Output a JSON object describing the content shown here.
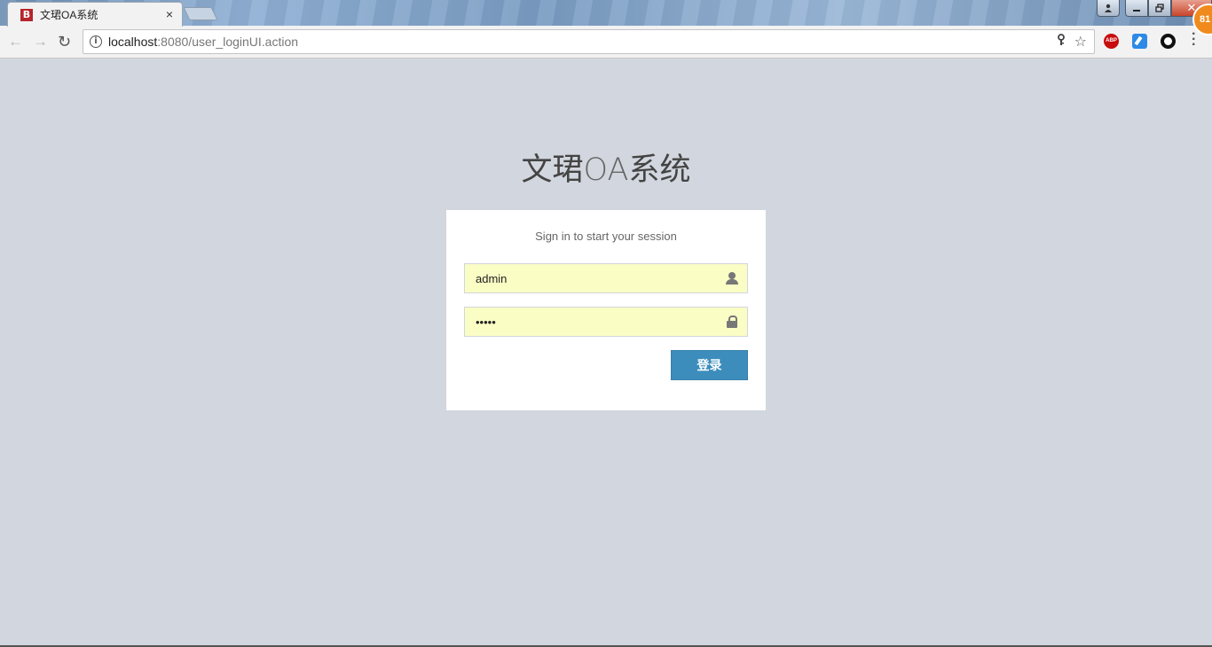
{
  "browser": {
    "tab": {
      "favicon_letter": "B",
      "title": "文珺OA系统",
      "close_glyph": "×"
    },
    "window_buttons": {
      "close_glyph": "✕",
      "badge_count": "81"
    },
    "address": {
      "host": "localhost",
      "path": ":8080/user_loginUI.action"
    },
    "extensions": {
      "abp_label": "ABP"
    }
  },
  "page": {
    "logo": {
      "bold_part": "文珺",
      "light_part": "OA",
      "bold_part_2": "系统"
    },
    "login": {
      "message": "Sign in to start your session",
      "username_value": "admin",
      "password_value": "admin",
      "submit_label": "登录"
    }
  },
  "colors": {
    "page_background": "#d2d6de",
    "button_primary": "#3c8dbc",
    "autofill_background": "#fafdc4"
  }
}
